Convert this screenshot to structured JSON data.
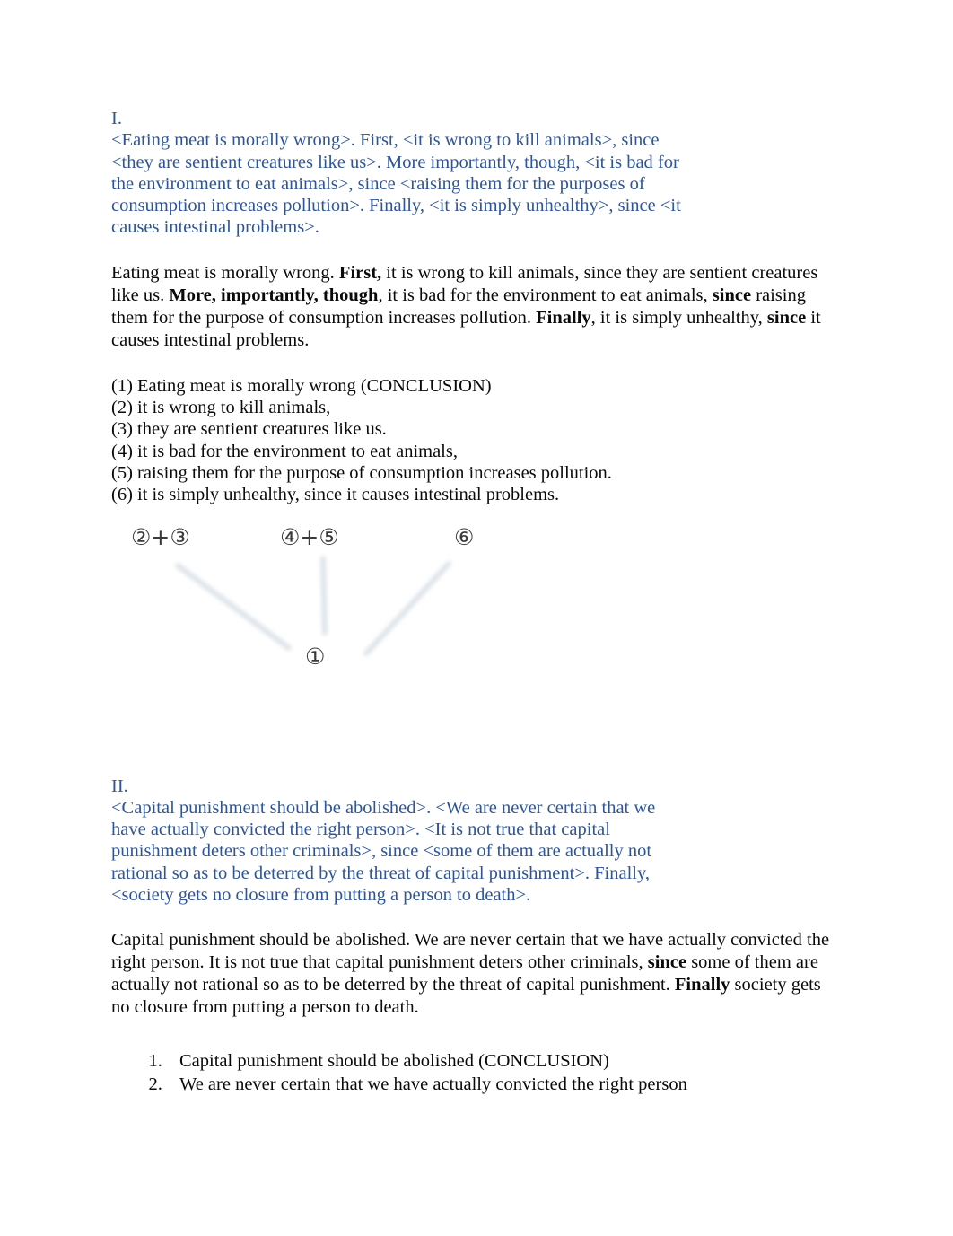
{
  "document": {
    "section_one": {
      "label": "I.",
      "quoted_passage_lines": [
        "<Eating meat is morally wrong>. First, <it is wrong to kill animals>, since",
        "<they are sentient creatures like us>. More importantly, though, <it is bad for",
        "the environment to eat animals>, since <raising them for the purposes of",
        "consumption increases pollution>. Finally, <it is simply unhealthy>, since <it",
        "causes intestinal problems>."
      ],
      "restated_paragraph": {
        "segments": [
          {
            "text": "Eating meat is morally wrong. ",
            "bold": false
          },
          {
            "text": "First,",
            "bold": true
          },
          {
            "text": " it is wrong to kill animals, since they are sentient creatures like us.  ",
            "bold": false
          },
          {
            "text": "More, importantly, though",
            "bold": true
          },
          {
            "text": ", it is bad for the environment to eat animals, ",
            "bold": false
          },
          {
            "text": "since",
            "bold": true
          },
          {
            "text": " raising them for the purpose of consumption increases pollution. ",
            "bold": false
          },
          {
            "text": "Finally",
            "bold": true
          },
          {
            "text": ", it is simply unhealthy, ",
            "bold": false
          },
          {
            "text": "since",
            "bold": true
          },
          {
            "text": " it causes intestinal problems.",
            "bold": false
          }
        ]
      },
      "numbered_statements": [
        "(1) Eating meat is morally wrong (CONCLUSION)",
        "(2) it is wrong to kill animals,",
        "(3) they are sentient creatures like us.",
        "(4) it is bad for the environment to eat animals,",
        "(5) raising them for the purpose of consumption increases pollution.",
        "(6) it is simply unhealthy, since it causes intestinal problems."
      ],
      "diagram": {
        "premise_nodes": [
          {
            "id": "group-2-3",
            "label": "②+③"
          },
          {
            "id": "group-4-5",
            "label": "④+⑤"
          },
          {
            "id": "node-6",
            "label": "⑥"
          }
        ],
        "conclusion_node": {
          "id": "node-1",
          "label": "①"
        },
        "arrow_color": "#dde3e9",
        "arrows": [
          {
            "from": "group-2-3",
            "to": "node-1"
          },
          {
            "from": "group-4-5",
            "to": "node-1"
          },
          {
            "from": "node-6",
            "to": "node-1"
          }
        ]
      }
    },
    "section_two": {
      "label": "II.",
      "quoted_passage_lines": [
        "<Capital punishment should be abolished>. <We are never certain that we",
        "have actually convicted the right person>. <It is not true that capital",
        "punishment deters other criminals>, since <some of them are actually not",
        "rational so as to be deterred by the threat of capital punishment>. Finally,",
        "<society gets no closure from putting a person to death>."
      ],
      "restated_paragraph": {
        "segments": [
          {
            "text": "Capital punishment should be abolished. We are never certain that we have actually convicted the right person.  It is not true that capital punishment deters other criminals, ",
            "bold": false
          },
          {
            "text": "since",
            "bold": true
          },
          {
            "text": " some of them are actually not rational so as to be deterred by the threat of capital punishment. ",
            "bold": false
          },
          {
            "text": "Finally",
            "bold": true
          },
          {
            "text": " society gets no closure from putting a person to death.",
            "bold": false
          }
        ]
      },
      "numbered_statements": [
        "Capital punishment should be abolished (CONCLUSION)",
        "We are never certain that we have actually convicted the right person"
      ]
    }
  },
  "colors": {
    "quoted_text": "#2E5597",
    "body_text": "#0a0a0a",
    "arrow": "#dde3e9",
    "page_background": "#ffffff"
  }
}
